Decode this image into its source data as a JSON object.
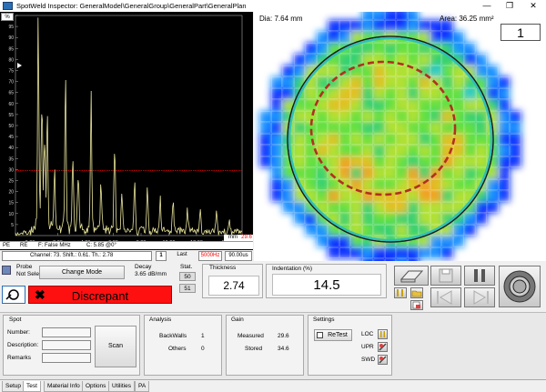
{
  "titlebar": {
    "title": "SpotWeld Inspector: GeneralModel\\GeneralGroup\\GeneralPart\\GeneralPlan",
    "minimize": "—",
    "restore": "❐",
    "close": "✕"
  },
  "ascan": {
    "percent_label": "%",
    "y_ticks": [
      "100",
      "95",
      "90",
      "85",
      "80",
      "75",
      "70",
      "65",
      "60",
      "55",
      "50",
      "45",
      "40",
      "35",
      "30",
      "25",
      "20",
      "15",
      "10",
      "5"
    ],
    "x_ticks": [
      "0.00",
      "2.00",
      "4.00",
      "6.00",
      "8.00",
      "10.00",
      "12.00",
      "14",
      "mm"
    ],
    "gate_value": "29.6",
    "status_pe": "PE",
    "status_re": "RE",
    "status_filter": "F: False MHz",
    "status_c": "C: 5.85 @0°",
    "gate_color": "#ff0000",
    "trace_color": "#e8e49a"
  },
  "channel": {
    "info": "Channel: 73. Shift.: 0.61. Th.: 2.78",
    "index": "1",
    "last": "Last",
    "freq": "5000Hz",
    "time": "90.00us"
  },
  "cscan": {
    "dia": "Dia: 7.64 mm",
    "area": "Area: 36.25 mm²",
    "counter": "1",
    "circle_color": "#2fc0b8",
    "ring_color": "#b03020"
  },
  "probe": {
    "label": "Probe",
    "value": "Not Sele",
    "change_mode": "Change Mode"
  },
  "decay": {
    "label": "Decay",
    "value": "3.65 dB/mm"
  },
  "stat": {
    "label": "Stat.",
    "v1": "50",
    "v2": "51"
  },
  "thickness": {
    "label": "Thickness",
    "value": "2.74"
  },
  "indentation": {
    "label": "Indentation (%)",
    "value": "14.5"
  },
  "verdict": {
    "label": "Discrepant",
    "color": "#ff1010"
  },
  "spot": {
    "title": "Spot",
    "number": "Number:",
    "description": "Description:",
    "remarks": "Remarks",
    "scan": "Scan"
  },
  "analysis": {
    "title": "Analysis",
    "backwalls_label": "BackWalls",
    "backwalls": "1",
    "others_label": "Others",
    "others": "0"
  },
  "gain": {
    "title": "Gain",
    "measured_label": "Measured",
    "measured": "29.6",
    "stored_label": "Stored",
    "stored": "34.6"
  },
  "settings": {
    "title": "Settings",
    "retest": "ReTest",
    "loc": "LOC",
    "upr": "UPR",
    "swd": "SWD"
  },
  "tabs": [
    "Setup",
    "Test",
    "Material Info",
    "Options",
    "Utilities",
    "PA"
  ],
  "active_tab": "Test"
}
